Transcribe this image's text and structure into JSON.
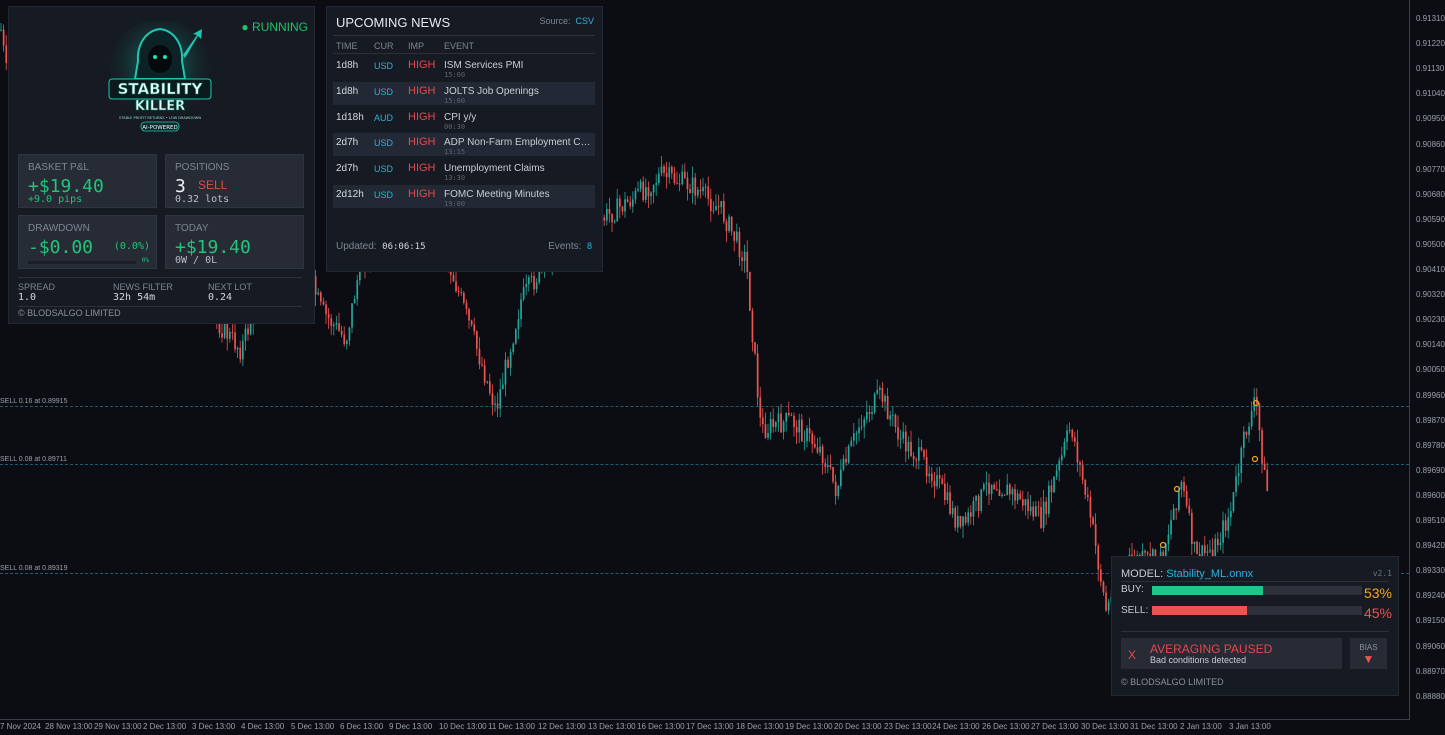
{
  "price_axis": [
    "0.91310",
    "0.91220",
    "0.91130",
    "0.91040",
    "0.90950",
    "0.90860",
    "0.90770",
    "0.90680",
    "0.90590",
    "0.90500",
    "0.90410",
    "0.90320",
    "0.90230",
    "0.90140",
    "0.90050",
    "0.89960",
    "0.89870",
    "0.89780",
    "0.89690",
    "0.89600",
    "0.89510",
    "0.89420",
    "0.89330",
    "0.89240",
    "0.89150",
    "0.89060",
    "0.88970",
    "0.88880"
  ],
  "time_axis": [
    "7 Nov 2024",
    "28 Nov 13:00",
    "29 Nov 13:00",
    "2 Dec 13:00",
    "3 Dec 13:00",
    "4 Dec 13:00",
    "5 Dec 13:00",
    "6 Dec 13:00",
    "9 Dec 13:00",
    "10 Dec 13:00",
    "11 Dec 13:00",
    "12 Dec 13:00",
    "13 Dec 13:00",
    "16 Dec 13:00",
    "17 Dec 13:00",
    "18 Dec 13:00",
    "19 Dec 13:00",
    "20 Dec 13:00",
    "23 Dec 13:00",
    "24 Dec 13:00",
    "26 Dec 13:00",
    "27 Dec 13:00",
    "30 Dec 13:00",
    "31 Dec 13:00",
    "2 Jan 13:00",
    "3 Jan 13:00"
  ],
  "order_lines": [
    "SELL 0.16 at 0.89915",
    "SELL 0.08 at 0.89711",
    "SELL 0.08 at 0.89319"
  ],
  "dashboard": {
    "status": "RUNNING",
    "logo_text": {
      "line1": "STABILITY",
      "line2": "KILLER",
      "tagline": "STABLE PROFIT RETURNS • LOW DRAWDOWN",
      "badge": "AI-POWERED"
    },
    "basket": {
      "title": "BASKET P&L",
      "value": "+$19.40",
      "sub": "+9.0 pips"
    },
    "positions": {
      "title": "POSITIONS",
      "count": "3",
      "side": "SELL",
      "sub": "0.32 lots"
    },
    "drawdown": {
      "title": "DRAWDOWN",
      "value": "-$0.00",
      "pct": "(0.0%)",
      "bar_label": "0%"
    },
    "today": {
      "title": "TODAY",
      "value": "+$19.40",
      "sub": "0W / 0L"
    },
    "stats": [
      {
        "label": "SPREAD",
        "value": "1.0"
      },
      {
        "label": "NEWS FILTER",
        "value": "32h 54m"
      },
      {
        "label": "NEXT LOT",
        "value": "0.24"
      }
    ],
    "copyright": "© BLODSALGO LIMITED"
  },
  "news": {
    "title": "UPCOMING NEWS",
    "source_label": "Source:",
    "source": "CSV",
    "headers": [
      "TIME",
      "CUR",
      "IMP",
      "EVENT"
    ],
    "rows": [
      {
        "time": "1d8h",
        "cur": "USD",
        "imp": "HIGH",
        "event": "ISM Services PMI",
        "at": "15:00"
      },
      {
        "time": "1d8h",
        "cur": "USD",
        "imp": "HIGH",
        "event": "JOLTS Job Openings",
        "at": "15:00"
      },
      {
        "time": "1d18h",
        "cur": "AUD",
        "imp": "HIGH",
        "event": "CPI y/y",
        "at": "00:30"
      },
      {
        "time": "2d7h",
        "cur": "USD",
        "imp": "HIGH",
        "event": "ADP Non-Farm Employment Ch...",
        "at": "13:15"
      },
      {
        "time": "2d7h",
        "cur": "USD",
        "imp": "HIGH",
        "event": "Unemployment Claims",
        "at": "13:30"
      },
      {
        "time": "2d12h",
        "cur": "USD",
        "imp": "HIGH",
        "event": "FOMC Meeting Minutes",
        "at": "19:00"
      }
    ],
    "updated_label": "Updated:",
    "updated": "06:06:15",
    "events_label": "Events:",
    "events": "8"
  },
  "model": {
    "label": "MODEL:",
    "name": "Stability_ML.onnx",
    "version": "v2.1",
    "buy_label": "BUY:",
    "buy_pct": "53%",
    "buy_fraction": 0.53,
    "sell_label": "SELL:",
    "sell_pct": "45%",
    "sell_fraction": 0.45,
    "status_icon": "X",
    "status": "AVERAGING PAUSED",
    "status_sub": "Bad conditions detected",
    "bias_label": "BIAS",
    "bias_icon": "▼",
    "copyright": "© BLODSALGO LIMITED"
  },
  "colors": {
    "bull": "#26a69a",
    "bear": "#ef5350",
    "accent": "#2bb3e0",
    "positive": "#23c47a",
    "negative": "#e5484d",
    "warning": "#f5a623"
  }
}
